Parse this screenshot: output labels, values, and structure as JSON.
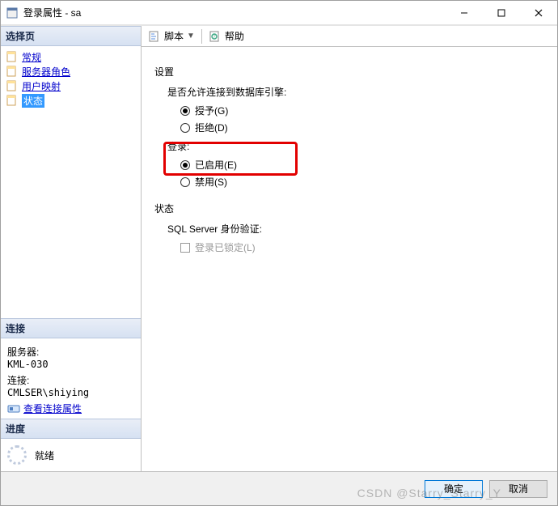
{
  "window": {
    "title": "登录属性 - sa"
  },
  "left": {
    "select_page_header": "选择页",
    "nav": [
      {
        "label": "常规"
      },
      {
        "label": "服务器角色"
      },
      {
        "label": "用户映射"
      },
      {
        "label": "状态"
      }
    ],
    "connection_header": "连接",
    "server_label": "服务器:",
    "server_value": "KML-030",
    "conn_label": "连接:",
    "conn_value": "CMLSER\\shiying",
    "view_conn_props": "查看连接属性",
    "progress_header": "进度",
    "progress_status": "就绪"
  },
  "toolbar": {
    "script": "脚本",
    "help": "帮助"
  },
  "content": {
    "settings_title": "设置",
    "perm_label": "是否允许连接到数据库引擎:",
    "perm_grant": "授予(G)",
    "perm_deny": "拒绝(D)",
    "login_label": "登录:",
    "login_enabled": "已启用(E)",
    "login_disabled": "禁用(S)",
    "status_title": "状态",
    "sql_auth_label": "SQL Server 身份验证:",
    "locked_label": "登录已锁定(L)"
  },
  "footer": {
    "ok": "确定",
    "cancel": "取消"
  },
  "watermark": "CSDN @Starry_Starry_Y"
}
